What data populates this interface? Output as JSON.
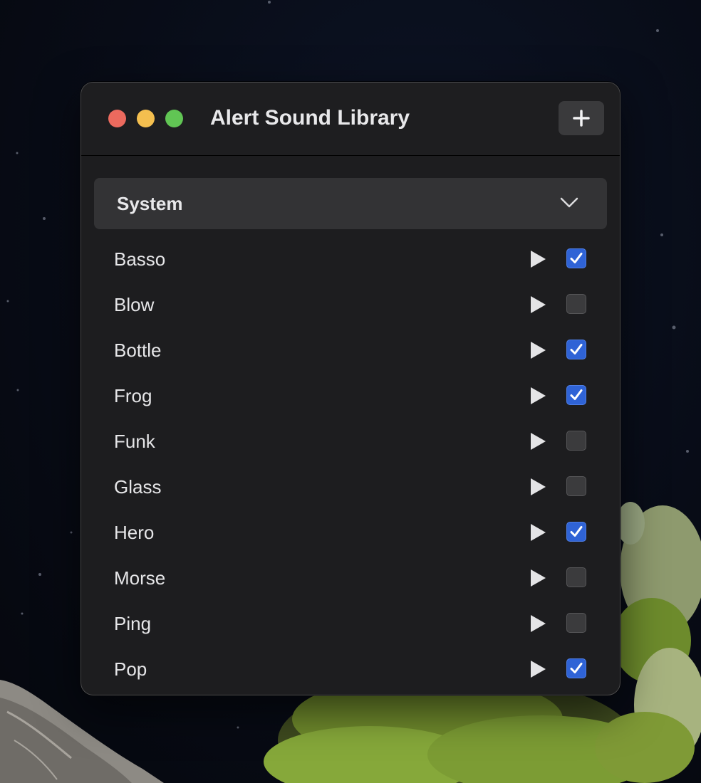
{
  "window": {
    "title": "Alert Sound Library",
    "add_button_icon": "plus-icon"
  },
  "category": {
    "selected": "System",
    "icon": "chevron-down-icon"
  },
  "sounds": [
    {
      "name": "Basso",
      "checked": true
    },
    {
      "name": "Blow",
      "checked": false
    },
    {
      "name": "Bottle",
      "checked": true
    },
    {
      "name": "Frog",
      "checked": true
    },
    {
      "name": "Funk",
      "checked": false
    },
    {
      "name": "Glass",
      "checked": false
    },
    {
      "name": "Hero",
      "checked": true
    },
    {
      "name": "Morse",
      "checked": false
    },
    {
      "name": "Ping",
      "checked": false
    },
    {
      "name": "Pop",
      "checked": true
    }
  ],
  "colors": {
    "accent": "#2f63d6",
    "close": "#ec6a5e",
    "minimize": "#f4bf4f",
    "maximize": "#61c554",
    "window_bg": "#1d1d1f"
  }
}
